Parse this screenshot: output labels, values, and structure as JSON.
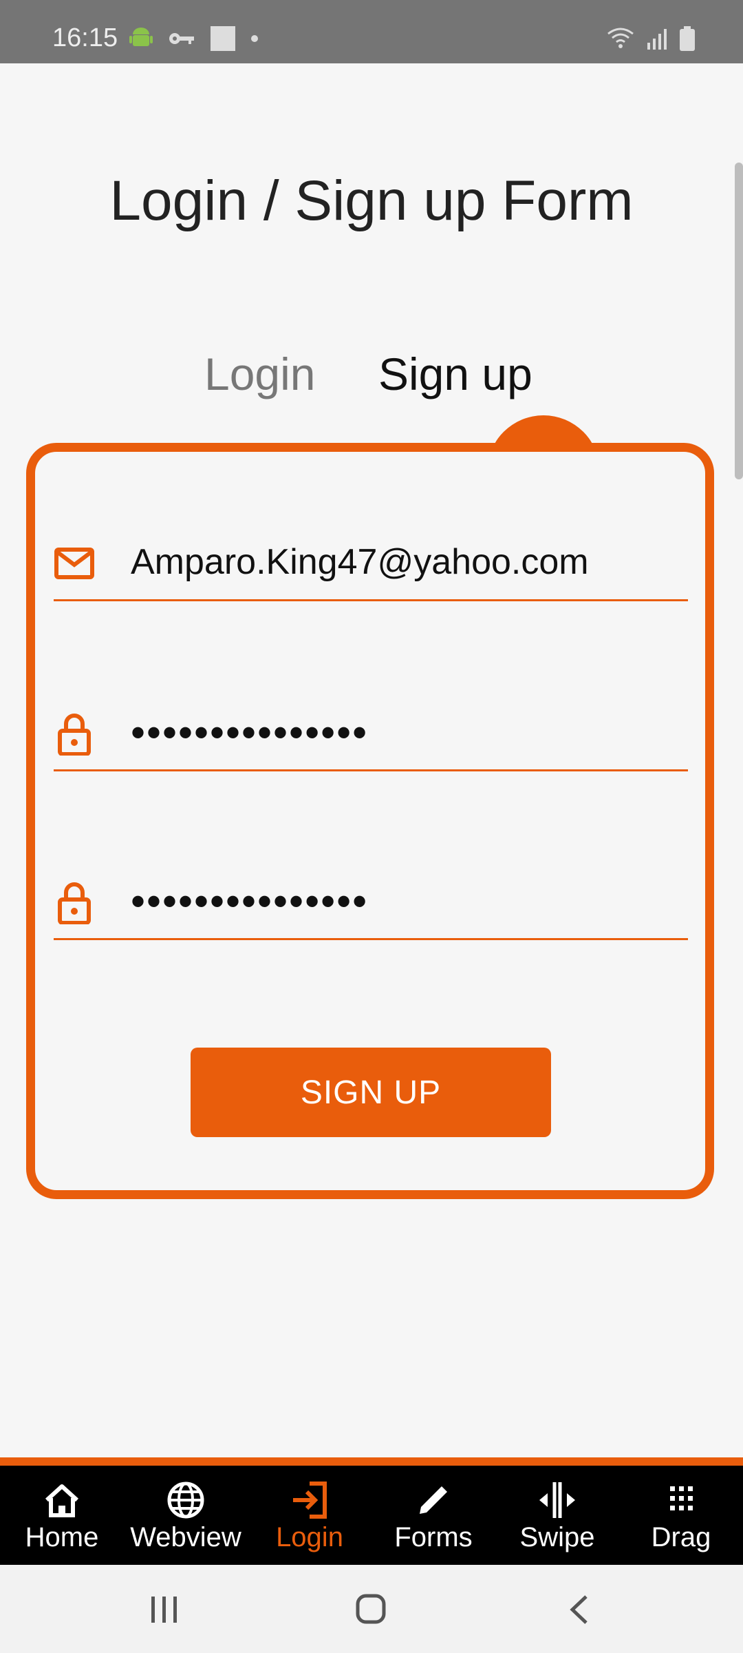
{
  "status_bar": {
    "time": "16:15",
    "left_icons": [
      "android-icon",
      "key-icon",
      "square-icon",
      "dot-icon"
    ],
    "right_icons": [
      "wifi-icon",
      "signal-icon",
      "battery-icon"
    ]
  },
  "page": {
    "title": "Login / Sign up Form"
  },
  "tabs": [
    {
      "label": "Login",
      "active": false
    },
    {
      "label": "Sign up",
      "active": true
    }
  ],
  "form": {
    "email": {
      "value": "Amparo.King47@yahoo.com",
      "icon": "mail-icon"
    },
    "password": {
      "value": "•••••••••••••••",
      "icon": "lock-icon"
    },
    "confirm_password": {
      "value": "•••••••••••••••",
      "icon": "lock-icon"
    },
    "submit_label": "SIGN UP"
  },
  "bottom_nav": {
    "items": [
      {
        "label": "Home",
        "icon": "home-icon"
      },
      {
        "label": "Webview",
        "icon": "globe-icon"
      },
      {
        "label": "Login",
        "icon": "login-icon",
        "active": true
      },
      {
        "label": "Forms",
        "icon": "pencil-icon"
      },
      {
        "label": "Swipe",
        "icon": "swipe-icon"
      },
      {
        "label": "Drag",
        "icon": "grid-icon"
      }
    ]
  },
  "colors": {
    "accent": "#e95d0c",
    "background": "#f6f6f6",
    "status_bar": "#757575",
    "nav_bar": "#000000"
  }
}
